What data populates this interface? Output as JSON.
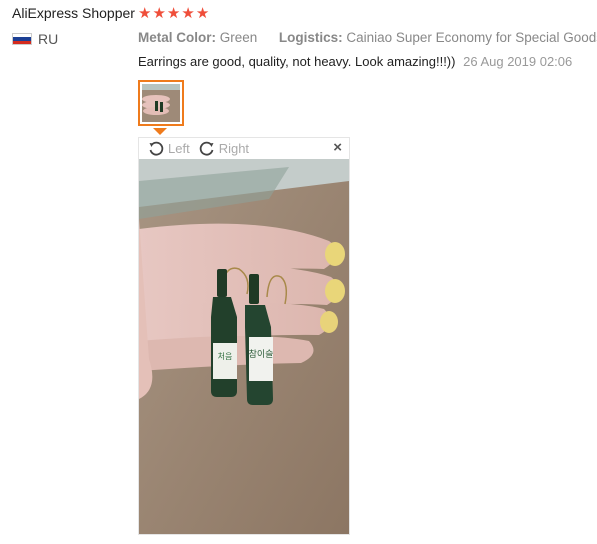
{
  "reviewer": {
    "name": "AliExpress Shopper",
    "rating": 5,
    "country": "RU"
  },
  "attributes": {
    "color_label": "Metal Color:",
    "color_value": "Green",
    "logistics_label": "Logistics:",
    "logistics_value": "Cainiao Super Economy for Special Goods"
  },
  "review": {
    "text": "Earrings are good, quality, not heavy. Look amazing!!!))",
    "date": "26 Aug 2019 02:06"
  },
  "viewer": {
    "rotate_left": "Left",
    "rotate_right": "Right",
    "close": "×"
  },
  "colors": {
    "star": "#ef4e3a",
    "accent": "#ef7b1c"
  },
  "icons": [
    "star-icon",
    "russia-flag-icon",
    "rotate-left-icon",
    "rotate-right-icon",
    "close-icon"
  ]
}
